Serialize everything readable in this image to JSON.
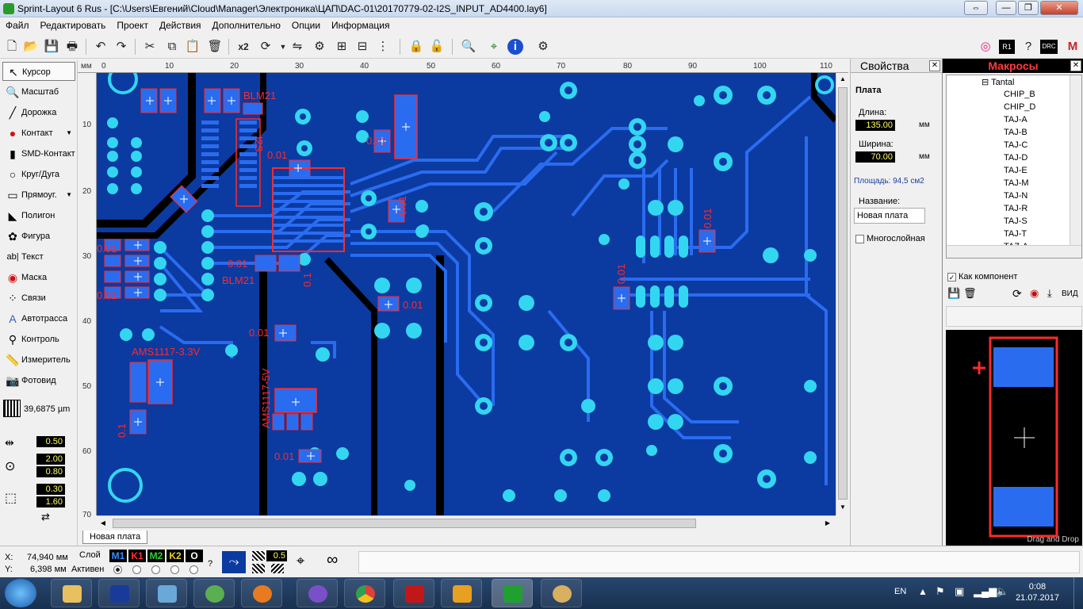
{
  "window": {
    "title": "Sprint-Layout 6 Rus - [C:\\Users\\Евгений\\Cloud\\Manager\\Электроника\\ЦАП\\DAC-01\\20170779-02-I2S_INPUT_AD4400.lay6]",
    "buttons": [
      "⇔",
      "—",
      "❐",
      "✕"
    ]
  },
  "menu": [
    "Файл",
    "Редактировать",
    "Проект",
    "Действия",
    "Дополнительно",
    "Опции",
    "Информация"
  ],
  "toolbar": {
    "x2_label": "x2"
  },
  "tools": [
    {
      "label": "Курсор",
      "icon": "cursor-icon"
    },
    {
      "label": "Масштаб",
      "icon": "zoom-icon"
    },
    {
      "label": "Дорожка",
      "icon": "track-icon"
    },
    {
      "label": "Контакт",
      "icon": "pad-icon"
    },
    {
      "label": "SMD-Контакт",
      "icon": "smd-pad-icon"
    },
    {
      "label": "Круг/Дуга",
      "icon": "circle-icon"
    },
    {
      "label": "Прямоуг.",
      "icon": "rectangle-icon"
    },
    {
      "label": "Полигон",
      "icon": "polygon-icon"
    },
    {
      "label": "Фигура",
      "icon": "figure-icon"
    },
    {
      "label": "Текст",
      "icon": "text-icon"
    },
    {
      "label": "Маска",
      "icon": "mask-icon"
    },
    {
      "label": "Связи",
      "icon": "connections-icon"
    },
    {
      "label": "Автотрасса",
      "icon": "autoroute-icon"
    },
    {
      "label": "Контроль",
      "icon": "drc-icon"
    },
    {
      "label": "Измеритель",
      "icon": "measure-icon"
    },
    {
      "label": "Фотовид",
      "icon": "photoview-icon"
    }
  ],
  "grid": {
    "value": "39,6875 µm"
  },
  "params": {
    "track_width": "0.50",
    "pad_outer": "2.00",
    "pad_inner": "0.80",
    "smd_w": "0.30",
    "smd_h": "1.60"
  },
  "ruler": {
    "unit": "мм",
    "top_ticks": [
      "0",
      "10",
      "20",
      "30",
      "40",
      "50",
      "60",
      "70",
      "80",
      "90",
      "100",
      "110"
    ],
    "left_ticks": [
      "10",
      "20",
      "30",
      "40",
      "50",
      "60",
      "70"
    ]
  },
  "board_labels": [
    "BLM21",
    "I2S",
    "0.01",
    "0.01",
    "0.01",
    "0.01",
    "BLM21",
    "0.01",
    "0.01",
    "AMS1117-3.3V",
    "AMS1117-5V",
    "0.01",
    "0.1",
    "0.01",
    "0.01",
    "0.01",
    "0.01",
    "0.1"
  ],
  "board_tab": "Новая плата",
  "properties": {
    "header": "Свойства",
    "section": "Плата",
    "length_label": "Длина:",
    "length_value": "135.00",
    "width_label": "Ширина:",
    "width_value": "70.00",
    "unit": "мм",
    "area": "Площадь: 94,5 см2",
    "name_label": "Название:",
    "name_value": "Новая плата",
    "multilayer": "Многослойная"
  },
  "macros": {
    "header": "Макросы",
    "tree_root": "Tantal",
    "tree_items": [
      "CHIP_B",
      "CHIP_D",
      "TAJ-A",
      "TAJ-B",
      "TAJ-C",
      "TAJ-D",
      "TAJ-E",
      "TAJ-M",
      "TAJ-N",
      "TAJ-R",
      "TAJ-S",
      "TAJ-T",
      "TAZ-A"
    ],
    "as_component": "Как компонент",
    "view_label": "ВИД",
    "drag_drop": "Drag and Drop",
    "toolbar_icons": [
      "DRC",
      "R1"
    ]
  },
  "status": {
    "x_label": "X:",
    "x_value": "74,940 мм",
    "y_label": "Y:",
    "y_value": "6,398 мм",
    "layer_label": "Слой",
    "active_label": "Активен",
    "layers": [
      {
        "name": "M1",
        "color": "#3a8cff"
      },
      {
        "name": "K1",
        "color": "#ff3030"
      },
      {
        "name": "M2",
        "color": "#30d030"
      },
      {
        "name": "K2",
        "color": "#e8d030"
      },
      {
        "name": "O",
        "color": "#ffffff"
      }
    ],
    "help": "?",
    "track_value": "0.5"
  },
  "taskbar": {
    "lang": "EN",
    "time": "0:08",
    "date": "21.07.2017"
  },
  "colors": {
    "board": "#0b3aa1",
    "copper": "#2a6cf0",
    "pad": "#33d6f0",
    "silk": "#ff2a2a"
  }
}
